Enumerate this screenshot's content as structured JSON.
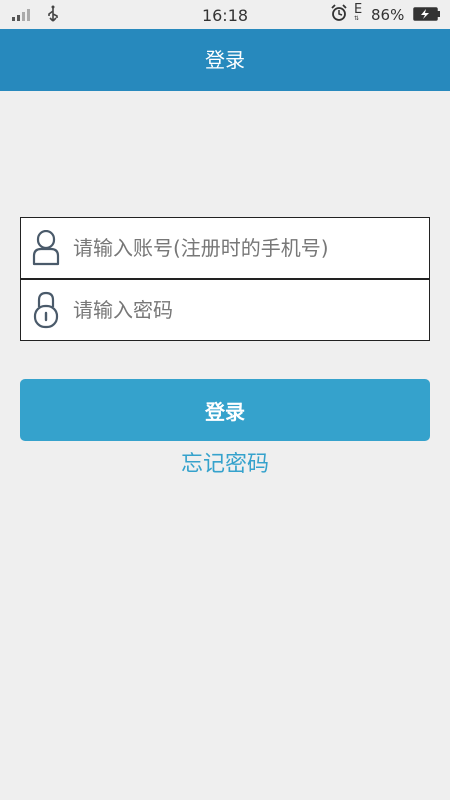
{
  "status_bar": {
    "time": "16:18",
    "network_type": "E",
    "battery_percent": "86%",
    "icons": [
      "signal-icon",
      "usb-icon",
      "alarm-icon",
      "battery-charging-icon"
    ]
  },
  "header": {
    "title": "登录"
  },
  "login_form": {
    "account_placeholder": "请输入账号(注册时的手机号)",
    "password_placeholder": "请输入密码",
    "account_icon": "user-icon",
    "password_icon": "lock-icon"
  },
  "actions": {
    "login_label": "登录",
    "forgot_password_label": "忘记密码"
  },
  "colors": {
    "header_bg": "#2789bd",
    "button_bg": "#35a2cc",
    "link_color": "#35a2cc",
    "page_bg": "#efefef"
  }
}
